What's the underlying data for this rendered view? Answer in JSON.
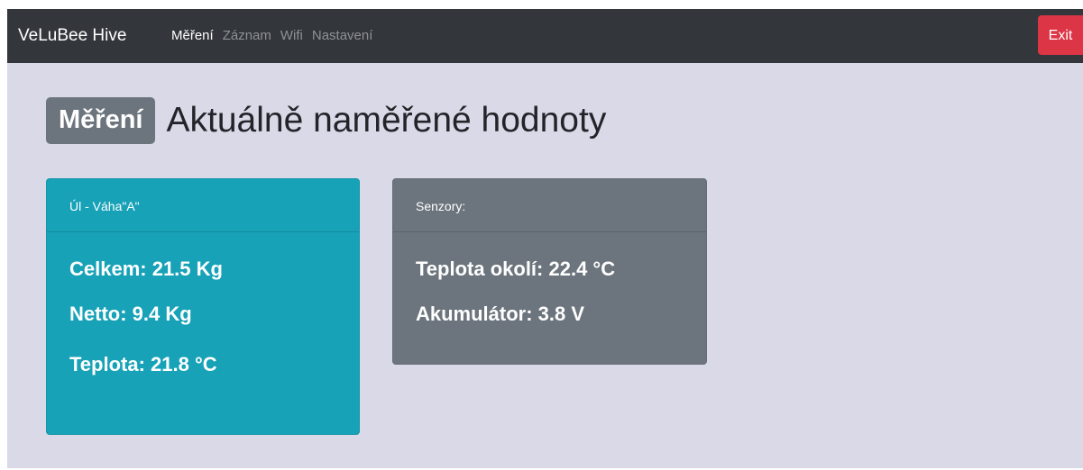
{
  "navbar": {
    "brand": "VeLuBee Hive",
    "links": [
      {
        "label": "Měření",
        "active": true
      },
      {
        "label": "Záznam",
        "active": false
      },
      {
        "label": "Wifi",
        "active": false
      },
      {
        "label": "Nastavení",
        "active": false
      }
    ],
    "exit_label": "Exit"
  },
  "heading": {
    "badge": "Měření",
    "title": "Aktuálně naměřené hodnoty"
  },
  "cards": {
    "weight": {
      "header": "Úl - Váha\"A\"",
      "total": "Celkem: 21.5 Kg",
      "net": "Netto: 9.4 Kg",
      "temperature": "Teplota: 21.8 °C"
    },
    "sensors": {
      "header": "Senzory:",
      "ambient_temperature": "Teplota okolí: 22.4 °C",
      "battery": "Akumulátor: 3.8 V"
    }
  },
  "colors": {
    "navbar_bg": "#33363b",
    "page_bg": "#dad9e7",
    "exit_red": "#dc3545",
    "teal_card": "#17a2b8",
    "gray_card": "#6c757d"
  }
}
